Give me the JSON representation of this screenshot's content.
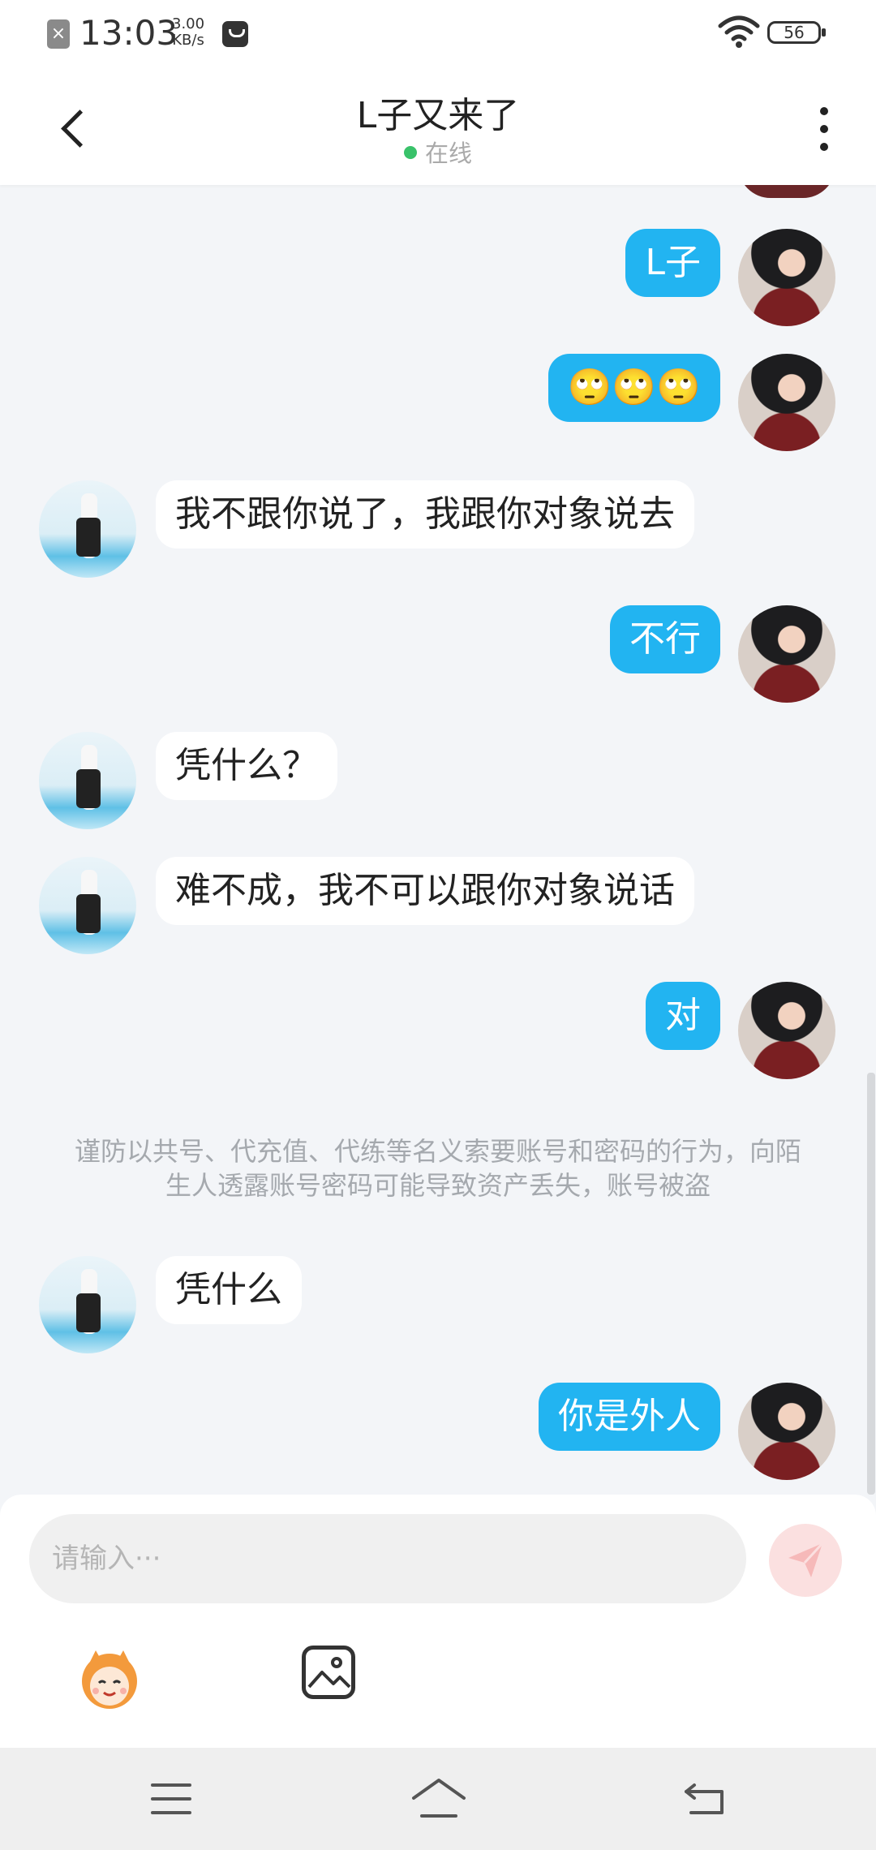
{
  "status_bar": {
    "time": "13:03",
    "speed_value": "3.00",
    "speed_unit": "KB/s",
    "battery": "56"
  },
  "header": {
    "title": "L子又来了",
    "status": "在线"
  },
  "messages": [
    {
      "side": "self",
      "text": "L子"
    },
    {
      "side": "self",
      "text": "🙄🙄🙄"
    },
    {
      "side": "other",
      "text": "我不跟你说了，我跟你对象说去"
    },
    {
      "side": "self",
      "text": "不行"
    },
    {
      "side": "other",
      "text": "凭什么？"
    },
    {
      "side": "other",
      "text": "难不成，我不可以跟你对象说话"
    },
    {
      "side": "self",
      "text": "对"
    },
    {
      "side": "notice",
      "text": "谨防以共号、代充值、代练等名义索要账号和密码的行为，向陌生人透露账号密码可能导致资产丢失，账号被盗"
    },
    {
      "side": "other",
      "text": "凭什么"
    },
    {
      "side": "self",
      "text": "你是外人"
    }
  ],
  "input": {
    "placeholder": "请输入···"
  },
  "colors": {
    "self_bubble": "#22b4f1",
    "other_bubble": "#ffffff",
    "online_dot": "#39c26a",
    "send_button": "#fbe0e0"
  },
  "icons": {
    "back": "chevron-left-icon",
    "more": "more-vertical-icon",
    "send": "paper-plane-icon",
    "emoji": "emoji-face-icon",
    "image": "image-icon",
    "nav_menu": "menu-icon",
    "nav_home": "home-icon",
    "nav_back": "back-arrow-icon"
  }
}
